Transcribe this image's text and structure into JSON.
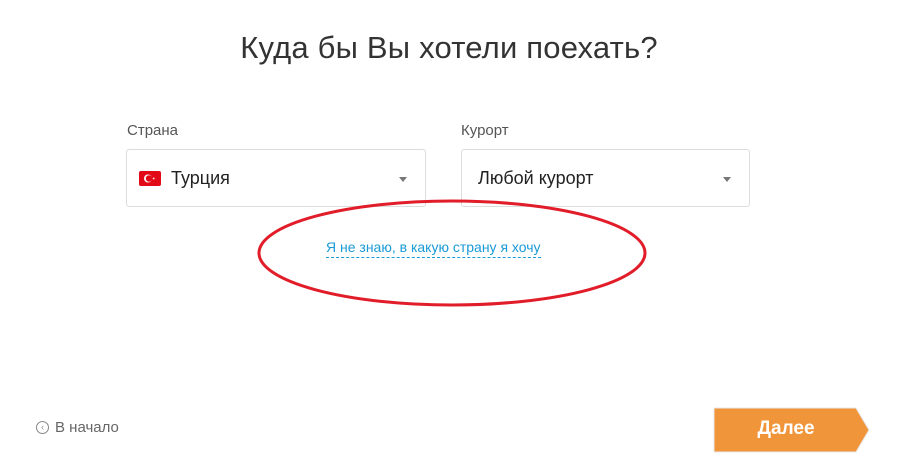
{
  "heading": "Куда бы Вы хотели поехать?",
  "country": {
    "label": "Страна",
    "value": "Турция",
    "flag_icon": "turkey-flag-icon"
  },
  "resort": {
    "label": "Курорт",
    "value": "Любой курорт"
  },
  "unknown_link": "Я не знаю, в какую страну я хочу",
  "back_link": "В начало",
  "next_button": "Далее",
  "colors": {
    "accent_orange": "#f0953a",
    "link_blue": "#1a9ad6",
    "annotation_red": "#e11d2a"
  }
}
